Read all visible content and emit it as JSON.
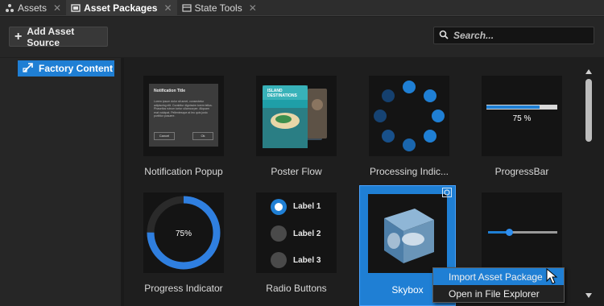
{
  "tabs": [
    {
      "label": "Assets",
      "icon": "assets-icon",
      "active": false
    },
    {
      "label": "Asset Packages",
      "icon": "asset-packages-icon",
      "active": true
    },
    {
      "label": "State Tools",
      "icon": "state-tools-icon",
      "active": false
    }
  ],
  "toolbar": {
    "add_source_label": "Add Asset Source",
    "search_placeholder": "Search..."
  },
  "sources": [
    {
      "label": "Factory Content",
      "icon": "factory-content-icon",
      "selected": true
    }
  ],
  "packages": [
    {
      "label": "Notification Popup",
      "preview": {
        "title": "Notification Title",
        "body": "Lorem ipsum dolor sit amet, consectetur adipiscing elit. Curabitur dignissim lorem tellus. Phasellus rutrum tortor ullamcorper. Aliquam erat volutpat. Pellentesque at leo quis justo porttitor posuere.",
        "cancel": "Cancel",
        "ok": "Ok"
      }
    },
    {
      "label": "Poster Flow",
      "preview": {
        "heading": "ISLAND DESTINATIONS"
      }
    },
    {
      "label": "Processing Indic...",
      "preview": {}
    },
    {
      "label": "ProgressBar",
      "preview": {
        "value_text": "75 %",
        "fraction": 0.75
      }
    },
    {
      "label": "Progress Indicator",
      "preview": {
        "value_text": "75%",
        "fraction": 0.75
      }
    },
    {
      "label": "Radio Buttons",
      "preview": {
        "options": [
          "Label 1",
          "Label 2",
          "Label 3"
        ],
        "selected_index": 0
      }
    },
    {
      "label": "Skybox",
      "selected": true,
      "preview": {}
    },
    {
      "label": "",
      "preview": {
        "slider_fraction": 0.3
      }
    }
  ],
  "context_menu": {
    "items": [
      "Import Asset Package",
      "Open in File Explorer"
    ],
    "hover_index": 0
  },
  "colors": {
    "accent": "#1f7fd4",
    "background": "#1e1e1e",
    "panel": "#262626"
  }
}
